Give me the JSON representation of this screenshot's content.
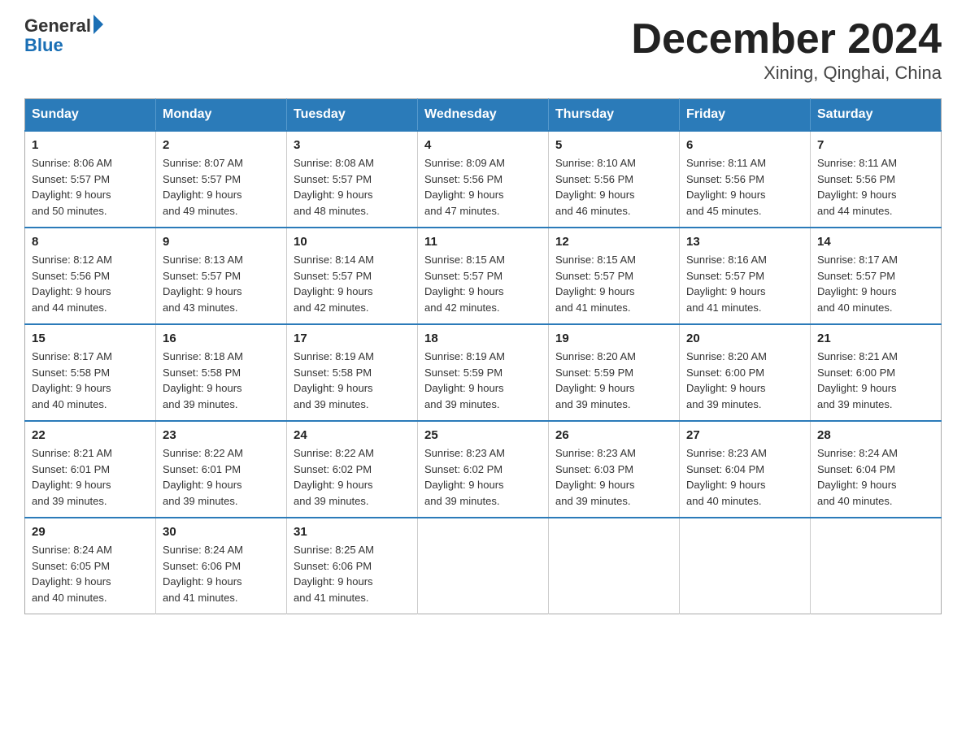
{
  "header": {
    "logo_text_general": "General",
    "logo_text_blue": "Blue",
    "title": "December 2024",
    "subtitle": "Xining, Qinghai, China"
  },
  "calendar": {
    "headers": [
      "Sunday",
      "Monday",
      "Tuesday",
      "Wednesday",
      "Thursday",
      "Friday",
      "Saturday"
    ],
    "rows": [
      [
        {
          "day": "1",
          "sunrise": "8:06 AM",
          "sunset": "5:57 PM",
          "daylight": "9 hours and 50 minutes."
        },
        {
          "day": "2",
          "sunrise": "8:07 AM",
          "sunset": "5:57 PM",
          "daylight": "9 hours and 49 minutes."
        },
        {
          "day": "3",
          "sunrise": "8:08 AM",
          "sunset": "5:57 PM",
          "daylight": "9 hours and 48 minutes."
        },
        {
          "day": "4",
          "sunrise": "8:09 AM",
          "sunset": "5:56 PM",
          "daylight": "9 hours and 47 minutes."
        },
        {
          "day": "5",
          "sunrise": "8:10 AM",
          "sunset": "5:56 PM",
          "daylight": "9 hours and 46 minutes."
        },
        {
          "day": "6",
          "sunrise": "8:11 AM",
          "sunset": "5:56 PM",
          "daylight": "9 hours and 45 minutes."
        },
        {
          "day": "7",
          "sunrise": "8:11 AM",
          "sunset": "5:56 PM",
          "daylight": "9 hours and 44 minutes."
        }
      ],
      [
        {
          "day": "8",
          "sunrise": "8:12 AM",
          "sunset": "5:56 PM",
          "daylight": "9 hours and 44 minutes."
        },
        {
          "day": "9",
          "sunrise": "8:13 AM",
          "sunset": "5:57 PM",
          "daylight": "9 hours and 43 minutes."
        },
        {
          "day": "10",
          "sunrise": "8:14 AM",
          "sunset": "5:57 PM",
          "daylight": "9 hours and 42 minutes."
        },
        {
          "day": "11",
          "sunrise": "8:15 AM",
          "sunset": "5:57 PM",
          "daylight": "9 hours and 42 minutes."
        },
        {
          "day": "12",
          "sunrise": "8:15 AM",
          "sunset": "5:57 PM",
          "daylight": "9 hours and 41 minutes."
        },
        {
          "day": "13",
          "sunrise": "8:16 AM",
          "sunset": "5:57 PM",
          "daylight": "9 hours and 41 minutes."
        },
        {
          "day": "14",
          "sunrise": "8:17 AM",
          "sunset": "5:57 PM",
          "daylight": "9 hours and 40 minutes."
        }
      ],
      [
        {
          "day": "15",
          "sunrise": "8:17 AM",
          "sunset": "5:58 PM",
          "daylight": "9 hours and 40 minutes."
        },
        {
          "day": "16",
          "sunrise": "8:18 AM",
          "sunset": "5:58 PM",
          "daylight": "9 hours and 39 minutes."
        },
        {
          "day": "17",
          "sunrise": "8:19 AM",
          "sunset": "5:58 PM",
          "daylight": "9 hours and 39 minutes."
        },
        {
          "day": "18",
          "sunrise": "8:19 AM",
          "sunset": "5:59 PM",
          "daylight": "9 hours and 39 minutes."
        },
        {
          "day": "19",
          "sunrise": "8:20 AM",
          "sunset": "5:59 PM",
          "daylight": "9 hours and 39 minutes."
        },
        {
          "day": "20",
          "sunrise": "8:20 AM",
          "sunset": "6:00 PM",
          "daylight": "9 hours and 39 minutes."
        },
        {
          "day": "21",
          "sunrise": "8:21 AM",
          "sunset": "6:00 PM",
          "daylight": "9 hours and 39 minutes."
        }
      ],
      [
        {
          "day": "22",
          "sunrise": "8:21 AM",
          "sunset": "6:01 PM",
          "daylight": "9 hours and 39 minutes."
        },
        {
          "day": "23",
          "sunrise": "8:22 AM",
          "sunset": "6:01 PM",
          "daylight": "9 hours and 39 minutes."
        },
        {
          "day": "24",
          "sunrise": "8:22 AM",
          "sunset": "6:02 PM",
          "daylight": "9 hours and 39 minutes."
        },
        {
          "day": "25",
          "sunrise": "8:23 AM",
          "sunset": "6:02 PM",
          "daylight": "9 hours and 39 minutes."
        },
        {
          "day": "26",
          "sunrise": "8:23 AM",
          "sunset": "6:03 PM",
          "daylight": "9 hours and 39 minutes."
        },
        {
          "day": "27",
          "sunrise": "8:23 AM",
          "sunset": "6:04 PM",
          "daylight": "9 hours and 40 minutes."
        },
        {
          "day": "28",
          "sunrise": "8:24 AM",
          "sunset": "6:04 PM",
          "daylight": "9 hours and 40 minutes."
        }
      ],
      [
        {
          "day": "29",
          "sunrise": "8:24 AM",
          "sunset": "6:05 PM",
          "daylight": "9 hours and 40 minutes."
        },
        {
          "day": "30",
          "sunrise": "8:24 AM",
          "sunset": "6:06 PM",
          "daylight": "9 hours and 41 minutes."
        },
        {
          "day": "31",
          "sunrise": "8:25 AM",
          "sunset": "6:06 PM",
          "daylight": "9 hours and 41 minutes."
        },
        null,
        null,
        null,
        null
      ]
    ]
  }
}
